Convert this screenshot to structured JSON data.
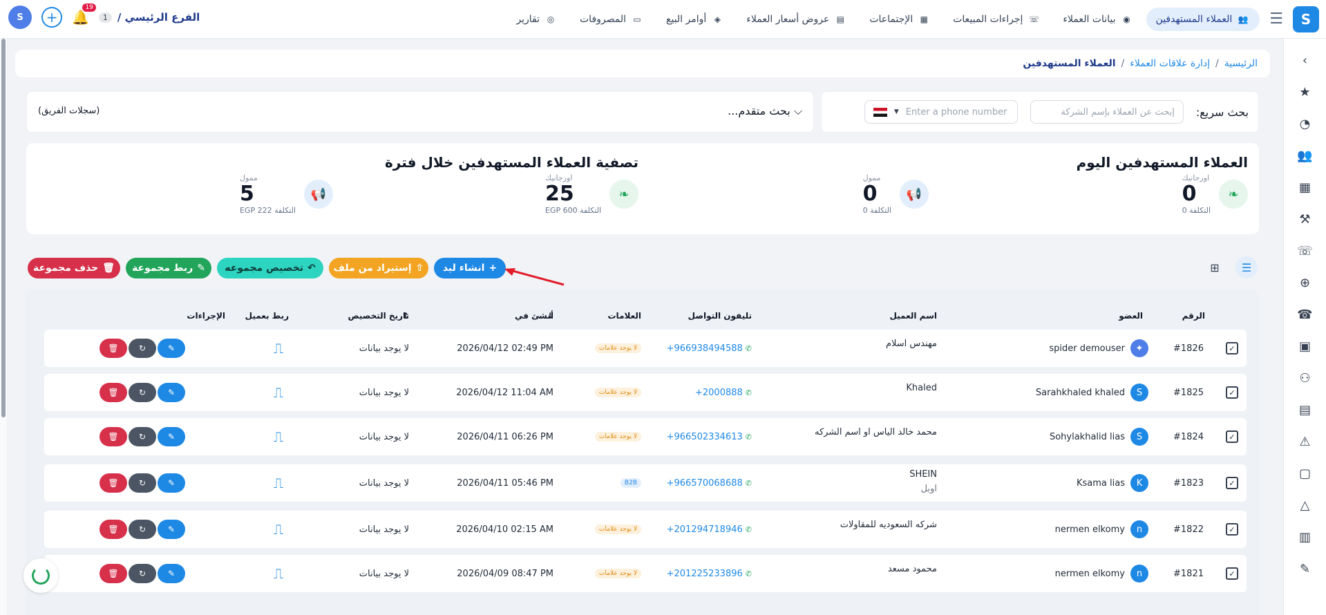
{
  "topbar": {
    "nav": [
      {
        "label": "العملاء المستهدفين",
        "icon": "target-users-icon",
        "active": true
      },
      {
        "label": "بيانات العملاء",
        "icon": "webcam-icon"
      },
      {
        "label": "إجراءات المبيعات",
        "icon": "phone-icon"
      },
      {
        "label": "الإجتماعات",
        "icon": "presentation-icon"
      },
      {
        "label": "عروض أسعار العملاء",
        "icon": "document-icon"
      },
      {
        "label": "أوامر البيع",
        "icon": "money-bag-icon"
      },
      {
        "label": "المصروفات",
        "icon": "monitor-icon"
      },
      {
        "label": "تقارير",
        "icon": "chart-icon"
      }
    ],
    "branch": "الفرع الرئيسي /",
    "branch_count": "1",
    "notif_count": "19"
  },
  "breadcrumb": {
    "home": "الرئيسية",
    "section": "إدارة علاقات العملاء",
    "current": "العملاء المستهدفين",
    "sep": "/"
  },
  "search": {
    "label": "بحث سريع:",
    "company_placeholder": "إبحث عن العملاء بإسم الشركة",
    "phone_placeholder": "Enter a phone number",
    "advanced": "بحث متقدم...",
    "team_records": "(سجلات الفريق)"
  },
  "stats": {
    "today_title": "العملاء المستهدفين اليوم",
    "period_title": "تصفية العملاء المستهدفين خلال فترة",
    "items": [
      {
        "kind": "اورجانيك",
        "value": "0",
        "cost": "التكلفة 0"
      },
      {
        "kind": "ممول",
        "value": "0",
        "cost": "التكلفة 0"
      },
      {
        "kind": "اورجانيك",
        "value": "25",
        "cost": "التكلفة 600 EGP"
      },
      {
        "kind": "ممول",
        "value": "5",
        "cost": "التكلفة 222 EGP"
      }
    ]
  },
  "actions": {
    "create": "انشاء ليد",
    "import": "إستيراد من ملف",
    "assign": "تخصيص مجموعه",
    "link": "ربط مجموعة",
    "delete": "حذف مجموعة"
  },
  "table": {
    "headers": {
      "num": "الرقم",
      "member": "العضو",
      "client": "اسم العميل",
      "phone": "تليفون التواصل",
      "tags": "العلامات",
      "created": "أنشئ في",
      "assigned": "تاريخ التخصيص",
      "link": "ربط بعميل",
      "actions": "الإجراءات"
    },
    "rows": [
      {
        "num": "#1826",
        "member": "spider demouser",
        "initial": "",
        "client": "مهندس اسلام",
        "client2": "",
        "phone": "+966938494588",
        "tag": "لا يوجد علامات",
        "tag_type": "none",
        "created": "2026/04/12 02:49 PM",
        "assigned": "لا يوجد بيانات"
      },
      {
        "num": "#1825",
        "member": "Sarahkhaled khaled",
        "initial": "S",
        "client": "Khaled",
        "client2": "",
        "phone": "+2000888",
        "tag": "لا يوجد علامات",
        "tag_type": "none",
        "created": "2026/04/12 11:04 AM",
        "assigned": "لا يوجد بيانات"
      },
      {
        "num": "#1824",
        "member": "Sohylakhalid lias",
        "initial": "S",
        "client": "محمد خالد الياس او اسم الشركه",
        "client2": "",
        "phone": "+966502334613",
        "tag": "لا يوجد علامات",
        "tag_type": "none",
        "created": "2026/04/11 06:26 PM",
        "assigned": "لا يوجد بيانات"
      },
      {
        "num": "#1823",
        "member": "Ksama lias",
        "initial": "K",
        "client": "SHEIN",
        "client2": "اوبل",
        "phone": "+966570068688",
        "tag": "B2B",
        "tag_type": "b2b",
        "created": "2026/04/11 05:46 PM",
        "assigned": "لا يوجد بيانات"
      },
      {
        "num": "#1822",
        "member": "nermen elkomy",
        "initial": "n",
        "client": "شركه السعوديه للمقاولات",
        "client2": "",
        "phone": "+201294718946",
        "tag": "لا يوجد علامات",
        "tag_type": "none",
        "created": "2026/04/10 02:15 AM",
        "assigned": "لا يوجد بيانات"
      },
      {
        "num": "#1821",
        "member": "nermen elkomy",
        "initial": "n",
        "client": "محمود مسعد",
        "client2": "",
        "phone": "+201225233896",
        "tag": "لا يوجد علامات",
        "tag_type": "none",
        "created": "2026/04/09 08:47 PM",
        "assigned": "لا يوجد بيانات"
      }
    ]
  },
  "colors": {
    "primary": "#1e88e5",
    "import": "#f2a422",
    "assign": "#2dd4bf",
    "link": "#22a55a",
    "delete": "#d6304a"
  }
}
